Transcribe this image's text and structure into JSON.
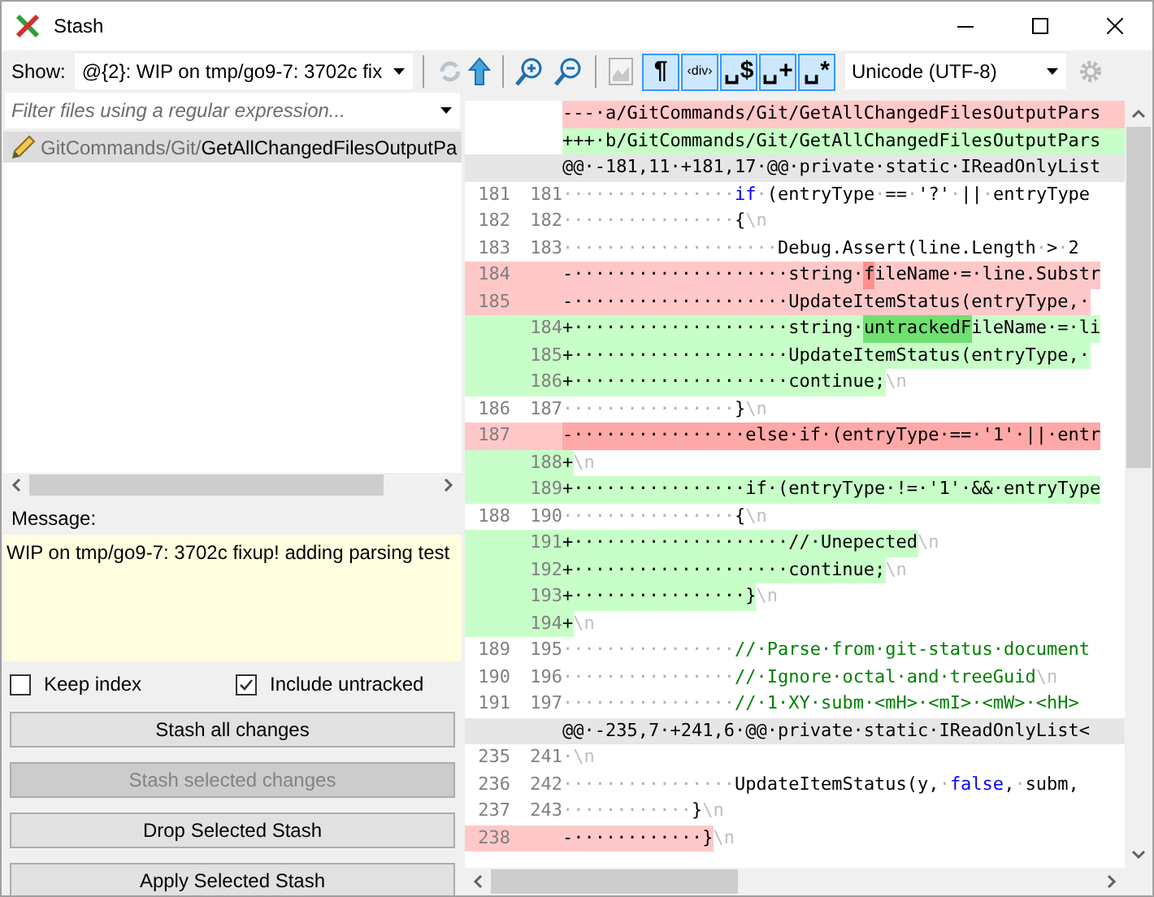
{
  "window": {
    "title": "Stash"
  },
  "show": {
    "label": "Show:",
    "value": "@{2}: WIP on tmp/go9-7: 3702c fix"
  },
  "filter": {
    "placeholder": "Filter files using a regular expression..."
  },
  "files": [
    {
      "dir": "GitCommands/Git/",
      "name": "GetAllChangedFilesOutputPa",
      "selected": true
    }
  ],
  "message": {
    "label": "Message:",
    "value": "WIP on tmp/go9-7: 3702c fixup! adding parsing test"
  },
  "options": [
    {
      "label": "Keep index",
      "checked": false
    },
    {
      "label": "Include untracked",
      "checked": true
    }
  ],
  "buttons": [
    {
      "label": "Stash all changes",
      "disabled": false
    },
    {
      "label": "Stash selected changes",
      "disabled": true
    },
    {
      "label": "Drop Selected Stash",
      "disabled": false
    },
    {
      "label": "Apply Selected Stash",
      "disabled": false
    }
  ],
  "toggles": [
    {
      "label": "¶",
      "selected": true
    },
    {
      "label": "‹div›",
      "selected": true
    },
    {
      "label": "␣$",
      "selected": true
    },
    {
      "label": "␣+",
      "selected": true
    },
    {
      "label": "␣*",
      "selected": true
    }
  ],
  "encoding": "Unicode (UTF-8)",
  "diff": [
    {
      "kind": "header_removed",
      "segs": [
        {
          "kind": "code",
          "text": "---·a/GitCommands/Git/GetAllChangedFilesOutputPars"
        }
      ]
    },
    {
      "kind": "header_added",
      "segs": [
        {
          "kind": "code",
          "text": "+++·b/GitCommands/Git/GetAllChangedFilesOutputPars"
        }
      ]
    },
    {
      "kind": "hunk",
      "segs": [
        {
          "kind": "code",
          "text": "@@·-181,11·+181,17·@@·private·static·IReadOnlyList"
        }
      ]
    },
    {
      "kind": "context",
      "old": "181",
      "new": "181",
      "segs": [
        {
          "kind": "ws",
          "text": "················"
        },
        {
          "kind": "kw",
          "text": "if"
        },
        {
          "kind": "ws",
          "text": "·"
        },
        {
          "kind": "code",
          "text": "(entryType"
        },
        {
          "kind": "ws",
          "text": "·"
        },
        {
          "kind": "code",
          "text": "=="
        },
        {
          "kind": "ws",
          "text": "·"
        },
        {
          "kind": "code",
          "text": "'?'"
        },
        {
          "kind": "ws",
          "text": "·"
        },
        {
          "kind": "code",
          "text": "||"
        },
        {
          "kind": "ws",
          "text": "·"
        },
        {
          "kind": "code",
          "text": "entryType"
        }
      ]
    },
    {
      "kind": "context",
      "old": "182",
      "new": "182",
      "segs": [
        {
          "kind": "ws",
          "text": "················"
        },
        {
          "kind": "code",
          "text": "{"
        },
        {
          "kind": "eol",
          "text": "\\n"
        }
      ]
    },
    {
      "kind": "context",
      "old": "183",
      "new": "183",
      "segs": [
        {
          "kind": "ws",
          "text": "····················"
        },
        {
          "kind": "code",
          "text": "Debug.Assert(line.Length"
        },
        {
          "kind": "ws",
          "text": "·"
        },
        {
          "kind": "code",
          "text": ">"
        },
        {
          "kind": "ws",
          "text": "·"
        },
        {
          "kind": "code",
          "text": "2"
        }
      ]
    },
    {
      "kind": "removed",
      "strong": false,
      "old": "184",
      "segs": [
        {
          "kind": "code",
          "text": "-····················string·"
        },
        {
          "kind": "hl",
          "text": "f"
        },
        {
          "kind": "code",
          "text": "ileName·=·line.Substr"
        }
      ]
    },
    {
      "kind": "removed",
      "strong": false,
      "old": "185",
      "segs": [
        {
          "kind": "code",
          "text": "-····················UpdateItemStatus(entryType,·"
        }
      ]
    },
    {
      "kind": "added",
      "new": "184",
      "segs": [
        {
          "kind": "code",
          "text": "+····················string·"
        },
        {
          "kind": "hl",
          "text": "untrackedF"
        },
        {
          "kind": "code",
          "text": "ileName·=·li"
        }
      ]
    },
    {
      "kind": "added",
      "new": "185",
      "segs": [
        {
          "kind": "code",
          "text": "+····················UpdateItemStatus(entryType,·"
        }
      ]
    },
    {
      "kind": "added",
      "new": "186",
      "segs": [
        {
          "kind": "code",
          "text": "+····················continue;"
        },
        {
          "kind": "eol",
          "text": "\\n"
        }
      ]
    },
    {
      "kind": "context",
      "old": "186",
      "new": "187",
      "segs": [
        {
          "kind": "ws",
          "text": "················"
        },
        {
          "kind": "code",
          "text": "}"
        },
        {
          "kind": "eol",
          "text": "\\n"
        }
      ]
    },
    {
      "kind": "removed",
      "strong": true,
      "old": "187",
      "segs": [
        {
          "kind": "code",
          "text": "-················else·if·(entryType·==·'1'·||·entr"
        }
      ]
    },
    {
      "kind": "added",
      "new": "188",
      "segs": [
        {
          "kind": "code",
          "text": "+"
        },
        {
          "kind": "eol",
          "text": "\\n"
        }
      ]
    },
    {
      "kind": "added",
      "new": "189",
      "segs": [
        {
          "kind": "code",
          "text": "+················if·(entryType·!=·'1'·&&·entryType"
        }
      ]
    },
    {
      "kind": "context",
      "old": "188",
      "new": "190",
      "segs": [
        {
          "kind": "ws",
          "text": "················"
        },
        {
          "kind": "code",
          "text": "{"
        },
        {
          "kind": "eol",
          "text": "\\n"
        }
      ]
    },
    {
      "kind": "added",
      "new": "191",
      "segs": [
        {
          "kind": "code",
          "text": "+····················//·Unepected"
        },
        {
          "kind": "eol",
          "text": "\\n"
        }
      ]
    },
    {
      "kind": "added",
      "new": "192",
      "segs": [
        {
          "kind": "code",
          "text": "+····················continue;"
        },
        {
          "kind": "eol",
          "text": "\\n"
        }
      ]
    },
    {
      "kind": "added",
      "new": "193",
      "segs": [
        {
          "kind": "code",
          "text": "+················}"
        },
        {
          "kind": "eol",
          "text": "\\n"
        }
      ]
    },
    {
      "kind": "added",
      "new": "194",
      "segs": [
        {
          "kind": "code",
          "text": "+"
        },
        {
          "kind": "eol",
          "text": "\\n"
        }
      ]
    },
    {
      "kind": "context",
      "old": "189",
      "new": "195",
      "segs": [
        {
          "kind": "ws",
          "text": "················"
        },
        {
          "kind": "comment",
          "text": "//·Parse·from·git-status·document"
        }
      ]
    },
    {
      "kind": "context",
      "old": "190",
      "new": "196",
      "segs": [
        {
          "kind": "ws",
          "text": "················"
        },
        {
          "kind": "comment",
          "text": "//·Ignore·octal·and·treeGuid"
        },
        {
          "kind": "eol",
          "text": "\\n"
        }
      ]
    },
    {
      "kind": "context",
      "old": "191",
      "new": "197",
      "segs": [
        {
          "kind": "ws",
          "text": "················"
        },
        {
          "kind": "comment",
          "text": "//·1·XY·subm·<mH>·<mI>·<mW>·<hH>"
        }
      ]
    },
    {
      "kind": "hunk",
      "segs": [
        {
          "kind": "code",
          "text": "@@·-235,7·+241,6·@@·private·static·IReadOnlyList<"
        }
      ]
    },
    {
      "kind": "context",
      "old": "235",
      "new": "241",
      "segs": [
        {
          "kind": "ws",
          "text": "·"
        },
        {
          "kind": "eol",
          "text": "\\n"
        }
      ]
    },
    {
      "kind": "context",
      "old": "236",
      "new": "242",
      "segs": [
        {
          "kind": "ws",
          "text": "················"
        },
        {
          "kind": "code",
          "text": "UpdateItemStatus(y,"
        },
        {
          "kind": "ws",
          "text": "·"
        },
        {
          "kind": "kw",
          "text": "false"
        },
        {
          "kind": "code",
          "text": ","
        },
        {
          "kind": "ws",
          "text": "·"
        },
        {
          "kind": "code",
          "text": "subm,"
        }
      ]
    },
    {
      "kind": "context",
      "old": "237",
      "new": "243",
      "segs": [
        {
          "kind": "ws",
          "text": "············"
        },
        {
          "kind": "code",
          "text": "}"
        },
        {
          "kind": "eol",
          "text": "\\n"
        }
      ]
    },
    {
      "kind": "removed",
      "strong": false,
      "old": "238",
      "segs": [
        {
          "kind": "code",
          "text": "-············}"
        },
        {
          "kind": "eol",
          "text": "\\n"
        }
      ]
    }
  ]
}
